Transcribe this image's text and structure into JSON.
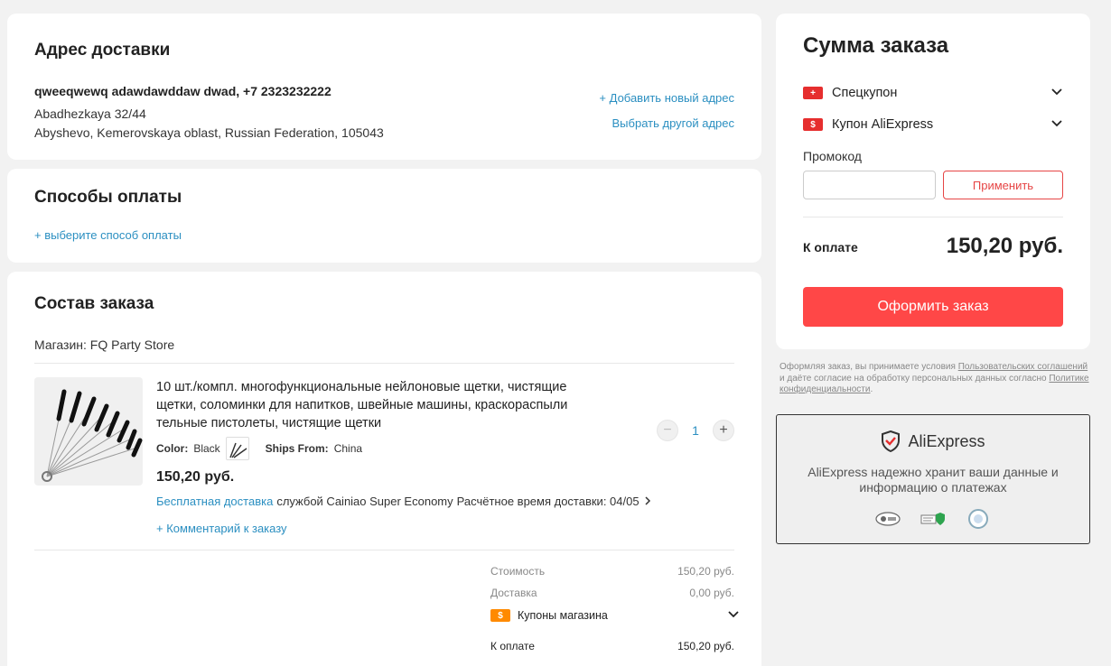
{
  "address": {
    "title": "Адрес доставки",
    "name": "qweeqwewq adawdawddaw dwad, +7 2323232222",
    "line1": "Abadhezkaya 32/44",
    "line2": "Abyshevo, Kemerovskaya oblast, Russian Federation, 105043",
    "add_link": "+ Добавить новый адрес",
    "choose_link": "Выбрать другой адрес"
  },
  "payment": {
    "title": "Способы оплаты",
    "choose_link": "+ выберите способ оплаты"
  },
  "order": {
    "title": "Состав заказа",
    "store": "Магазин: FQ Party Store",
    "item": {
      "title": "10 шт./компл. многофункциональные нейлоновые щетки, чистящие щетки, соломинки для напитков, швейные машины, краскораспылительные пистолеты, чистящие щетки",
      "color_label": "Color:",
      "color_value": "Black",
      "ships_label": "Ships From:",
      "ships_value": "China",
      "price": "150,20 руб.",
      "free_shipping": "Бесплатная доставка",
      "carrier": "службой Cainiao Super Economy",
      "delivery_time": "Расчётное время доставки: 04/05",
      "comment_link": "+ Комментарий к заказу",
      "quantity": "1"
    },
    "totals": {
      "cost_label": "Стоимость",
      "cost_value": "150,20 руб.",
      "delivery_label": "Доставка",
      "delivery_value": "0,00 руб.",
      "coupons_label": "Купоны магазина",
      "pay_label": "К оплате",
      "pay_value": "150,20 руб."
    }
  },
  "summary": {
    "title": "Сумма заказа",
    "special_coupon": "Спецкупон",
    "ae_coupon": "Купон AliExpress",
    "promo_label": "Промокод",
    "promo_placeholder": "",
    "apply_label": "Применить",
    "pay_label": "К оплате",
    "pay_value": "150,20 руб.",
    "order_button": "Оформить заказ"
  },
  "terms": {
    "t1": "Оформляя заказ, вы принимаете условия ",
    "link1": "Пользовательских соглашений",
    "t2": " и даёте согласие на обработку персональных данных согласно ",
    "link2": "Политике конфиденциальности",
    "t3": "."
  },
  "secure": {
    "brand": "AliExpress",
    "text": "AliExpress надежно хранит ваши данные и информацию о платежах"
  },
  "colors": {
    "accent_red": "#ff4747",
    "link_blue": "#2b8fc1",
    "coupon_orange": "#ff8a00"
  }
}
